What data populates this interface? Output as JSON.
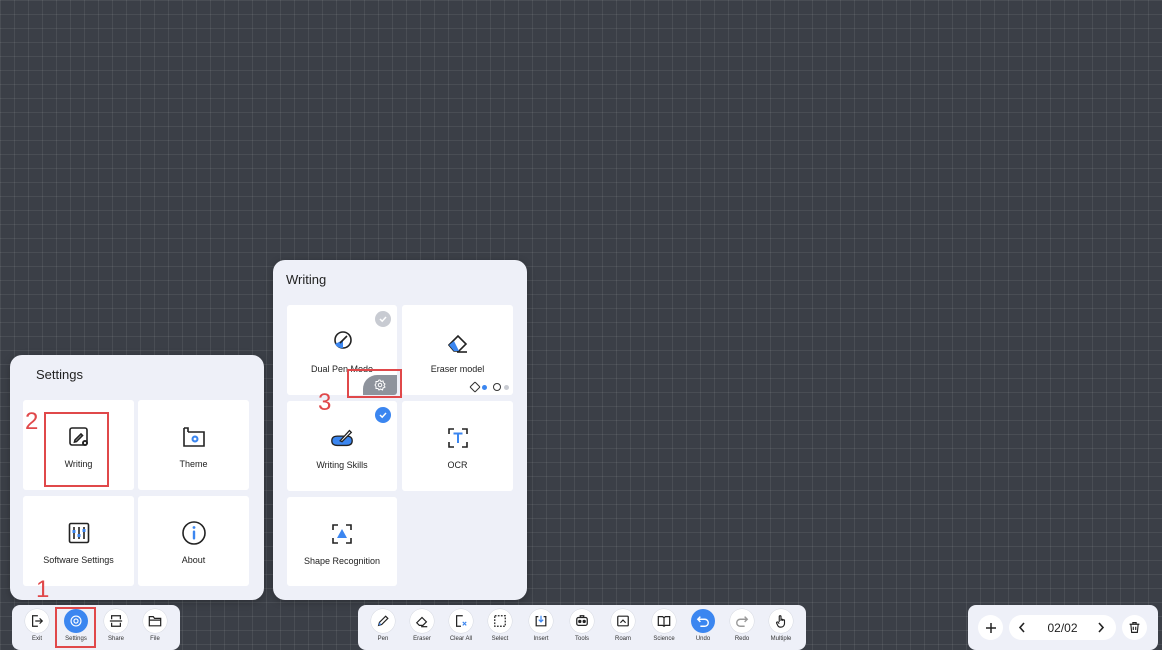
{
  "settings_panel": {
    "title": "Settings",
    "tiles": [
      {
        "label": "Writing"
      },
      {
        "label": "Theme"
      },
      {
        "label": "Software Settings"
      },
      {
        "label": "About"
      }
    ]
  },
  "writing_panel": {
    "title": "Writing",
    "tiles": [
      {
        "label": "Dual Pen Mode"
      },
      {
        "label": "Eraser model"
      },
      {
        "label": "Writing Skills"
      },
      {
        "label": "OCR"
      },
      {
        "label": "Shape Recognition"
      }
    ]
  },
  "annotations": {
    "one": "1",
    "two": "2",
    "three": "3"
  },
  "left_toolbar": [
    {
      "label": "Exit",
      "icon": "exit-icon"
    },
    {
      "label": "Settings",
      "icon": "gear-icon"
    },
    {
      "label": "Share",
      "icon": "share-icon"
    },
    {
      "label": "File",
      "icon": "folder-icon"
    }
  ],
  "main_toolbar": [
    {
      "label": "Pen",
      "icon": "pen-icon"
    },
    {
      "label": "Eraser",
      "icon": "eraser-icon"
    },
    {
      "label": "Clear All",
      "icon": "clear-all-icon"
    },
    {
      "label": "Select",
      "icon": "select-icon"
    },
    {
      "label": "Insert",
      "icon": "insert-icon"
    },
    {
      "label": "Tools",
      "icon": "tools-icon"
    },
    {
      "label": "Roam",
      "icon": "roam-icon"
    },
    {
      "label": "Science",
      "icon": "book-icon"
    },
    {
      "label": "Undo",
      "icon": "undo-icon"
    },
    {
      "label": "Redo",
      "icon": "redo-icon"
    },
    {
      "label": "Multiple",
      "icon": "hand-icon"
    }
  ],
  "page_nav": {
    "page_indicator": "02/02"
  },
  "colors": {
    "accent": "#3b86f0",
    "annotation": "#e0484a",
    "panel": "#eef0f8",
    "background": "#3b3f47"
  }
}
